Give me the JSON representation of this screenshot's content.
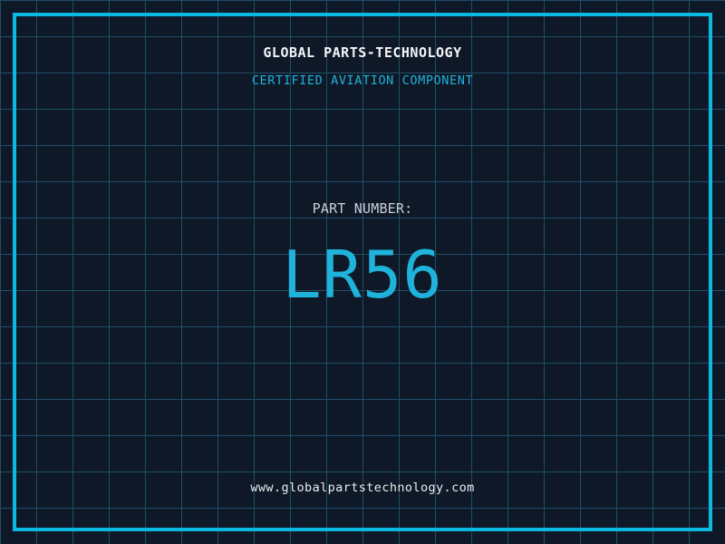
{
  "colors": {
    "bg": "#0f1827",
    "grid": "#1d4f68",
    "frame": "#0cb7e2",
    "accent": "#1fb2da",
    "title": "#f4f6f8",
    "label": "#c7d0d8",
    "url": "#e9edf1"
  },
  "header": {
    "company_name": "GLOBAL PARTS-TECHNOLOGY",
    "tagline": "CERTIFIED AVIATION COMPONENT"
  },
  "part": {
    "label": "PART NUMBER:",
    "number": "LR56"
  },
  "footer": {
    "website": "www.globalpartstechnology.com"
  }
}
